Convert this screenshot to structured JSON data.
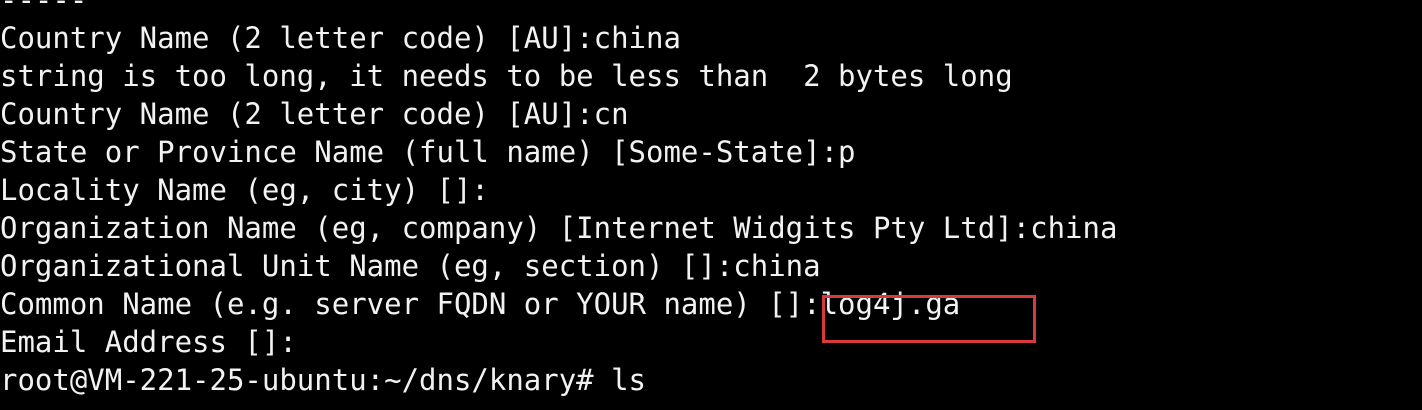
{
  "terminal": {
    "lines": [
      "-----",
      "Country Name (2 letter code) [AU]:china",
      "string is too long, it needs to be less than  2 bytes long",
      "Country Name (2 letter code) [AU]:cn",
      "State or Province Name (full name) [Some-State]:p",
      "Locality Name (eg, city) []:",
      "Organization Name (eg, company) [Internet Widgits Pty Ltd]:china",
      "Organizational Unit Name (eg, section) []:china",
      "Common Name (e.g. server FQDN or YOUR name) []:log4j.ga",
      "Email Address []:",
      "root@VM-221-25-ubuntu:~/dns/knary# ls"
    ]
  },
  "colors": {
    "background": "#000000",
    "text": "#f2f2f2",
    "highlight_border": "#d83a3a"
  }
}
